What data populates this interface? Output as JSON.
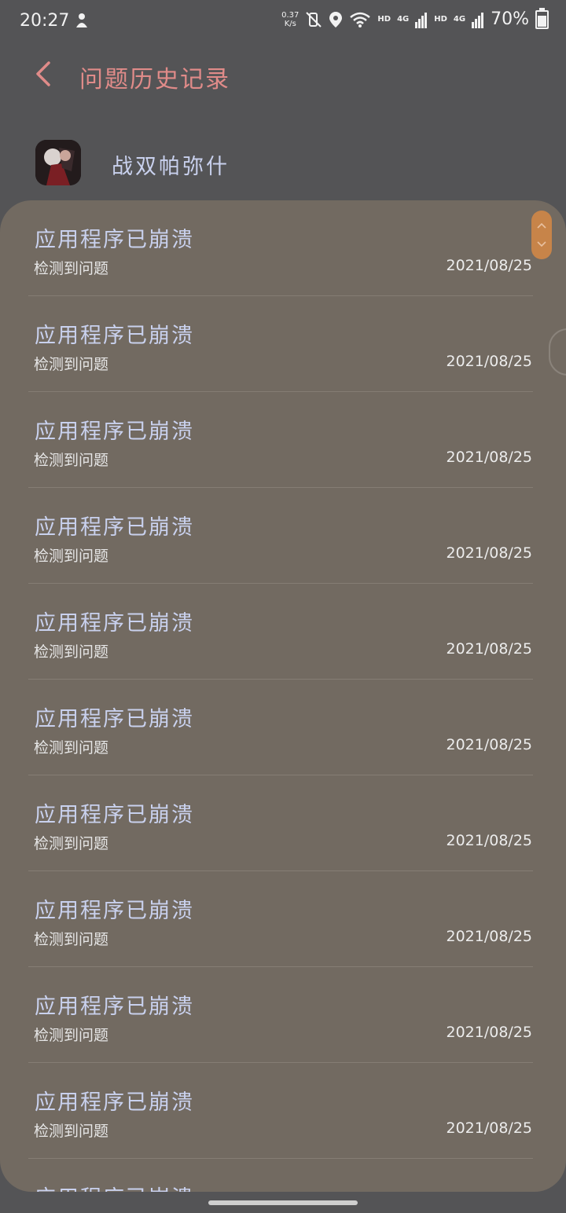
{
  "status_bar": {
    "time": "20:27",
    "speed_value": "0.37",
    "speed_unit": "K/s",
    "hd1": "HD",
    "net1": "4G",
    "hd2": "HD",
    "net2": "4G",
    "battery": "70%"
  },
  "header": {
    "title": "问题历史记录"
  },
  "app": {
    "name": "战双帕弥什"
  },
  "items": [
    {
      "title": "应用程序已崩溃",
      "subtitle": "检测到问题",
      "date": "2021/08/25"
    },
    {
      "title": "应用程序已崩溃",
      "subtitle": "检测到问题",
      "date": "2021/08/25"
    },
    {
      "title": "应用程序已崩溃",
      "subtitle": "检测到问题",
      "date": "2021/08/25"
    },
    {
      "title": "应用程序已崩溃",
      "subtitle": "检测到问题",
      "date": "2021/08/25"
    },
    {
      "title": "应用程序已崩溃",
      "subtitle": "检测到问题",
      "date": "2021/08/25"
    },
    {
      "title": "应用程序已崩溃",
      "subtitle": "检测到问题",
      "date": "2021/08/25"
    },
    {
      "title": "应用程序已崩溃",
      "subtitle": "检测到问题",
      "date": "2021/08/25"
    },
    {
      "title": "应用程序已崩溃",
      "subtitle": "检测到问题",
      "date": "2021/08/25"
    },
    {
      "title": "应用程序已崩溃",
      "subtitle": "检测到问题",
      "date": "2021/08/25"
    },
    {
      "title": "应用程序已崩溃",
      "subtitle": "检测到问题",
      "date": "2021/08/25"
    },
    {
      "title": "应用程序已崩溃",
      "subtitle": "",
      "date": ""
    }
  ],
  "colors": {
    "background": "#545456",
    "card": "#726a61",
    "accent_title": "#e08b89",
    "item_title": "#c9d1ee",
    "scroll_thumb": "#c78449"
  },
  "icons": {
    "back": "chevron-left-icon",
    "notification": "notification-icon",
    "mute": "vibrate-off-icon",
    "location": "location-icon",
    "wifi": "wifi-icon",
    "signal": "signal-icon",
    "battery": "battery-charging-icon"
  }
}
